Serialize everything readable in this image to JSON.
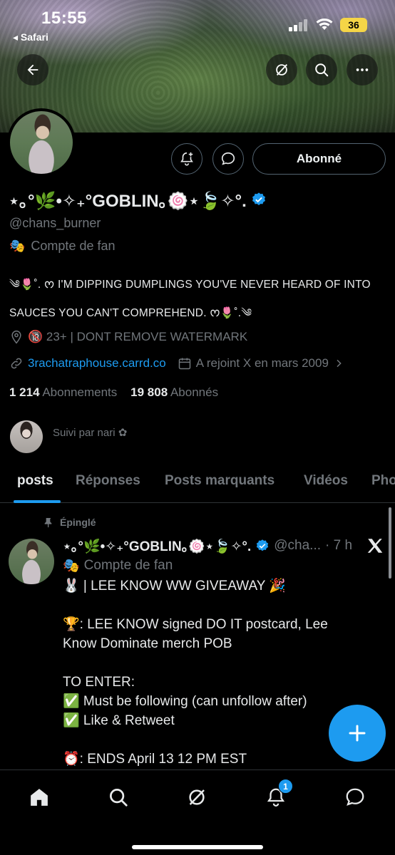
{
  "status_bar": {
    "time": "15:55",
    "back_app": "◂ Safari",
    "battery": "36"
  },
  "profile": {
    "follow_button": "Abonné",
    "display_name": "⋆｡°🌿•✧₊°GOBLIN｡🍥⋆🍃✧°.",
    "handle": "@chans_burner",
    "category": "Compte de fan",
    "bio_line1": "༄🌷˚. ᰔ I'M DIPPING DUMPLINGS YOU'VE NEVER HEARD OF INTO",
    "bio_line2": "SAUCES YOU CAN'T COMPREHEND. ᰔ🌷˚.༄",
    "location": "🔞 23+ | DONT REMOVE WATERMARK",
    "website": "3rachatraphouse.carrd.co",
    "joined": "A rejoint X en mars 2009",
    "following_count": "1 214",
    "following_label": "Abonnements",
    "followers_count": "19 808",
    "followers_label": "Abonnés",
    "followed_by": "Suivi par nari ✿"
  },
  "tabs": [
    "posts",
    "Réponses",
    "Posts marquants",
    "Vidéos",
    "Pho"
  ],
  "post": {
    "pinned_label": "Épinglé",
    "name": "⋆｡°🌿•✧₊°GOBLIN｡🍥⋆🍃✧°.",
    "handle": "@cha...",
    "time": "· 7 h",
    "category": "Compte de fan",
    "lines": [
      "🐰 | LEE KNOW WW GIVEAWAY 🎉",
      "",
      "🏆: LEE KNOW signed DO IT postcard, Lee Know Dominate merch POB",
      "",
      "TO ENTER:",
      "✅ Must be following (can unfollow after)",
      "✅ Like & Retweet",
      "",
      "⏰: ENDS April 13 12 PM EST"
    ]
  },
  "nav": {
    "notification_badge": "1"
  },
  "colors": {
    "accent": "#1d9bf0",
    "muted": "#71767b",
    "text": "#e7e9ea",
    "background": "#000000"
  },
  "icons": [
    "back-arrow-icon",
    "grok-icon",
    "search-icon",
    "more-icon",
    "notify-bell-plus-icon",
    "message-icon",
    "verified-badge-icon",
    "location-icon",
    "link-icon",
    "calendar-icon",
    "chevron-right-icon",
    "pin-icon",
    "x-logo-icon",
    "plus-icon",
    "home-icon",
    "bell-icon"
  ]
}
